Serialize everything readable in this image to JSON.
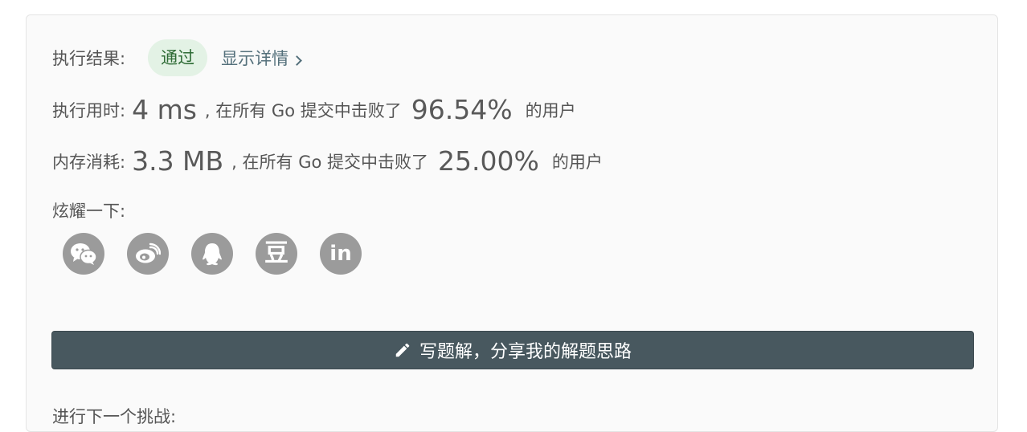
{
  "result": {
    "label": "执行结果:",
    "status": "通过",
    "details_link": "显示详情"
  },
  "runtime": {
    "label": "执行用时:",
    "value": "4 ms",
    "mid_text": ", 在所有 Go 提交中击败了",
    "percent": "96.54%",
    "suffix": "的用户"
  },
  "memory": {
    "label": "内存消耗:",
    "value": "3.3 MB",
    "mid_text": ", 在所有 Go 提交中击败了",
    "percent": "25.00%",
    "suffix": "的用户"
  },
  "share": {
    "label": "炫耀一下:",
    "icons": [
      "wechat-icon",
      "weibo-icon",
      "qq-icon",
      "douban-icon",
      "linkedin-icon"
    ],
    "douban_glyph": "豆",
    "linkedin_glyph": "in"
  },
  "write_solution": {
    "label": "写题解，分享我的解题思路",
    "icon": "pencil-icon"
  },
  "next_challenge": {
    "label": "进行下一个挑战:"
  },
  "colors": {
    "panel_bg": "#fafafa",
    "badge_bg": "#e3f2e5",
    "badge_text": "#2e6b35",
    "link": "#54707b",
    "icon_bg": "#9b9b9b",
    "button_bg": "#48585f"
  }
}
